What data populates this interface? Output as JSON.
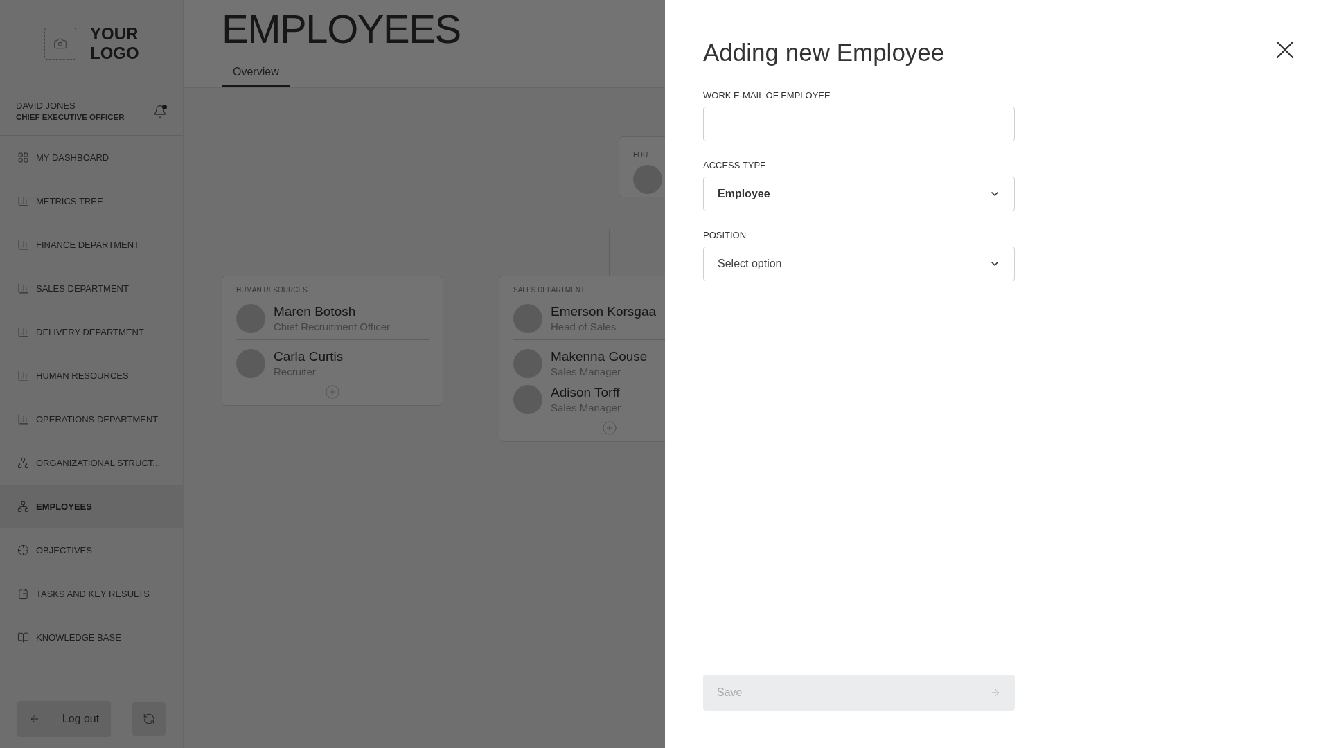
{
  "sidebar": {
    "logo_text": "YOUR LOGO",
    "user": {
      "name": "DAVID JONES",
      "role": "CHIEF EXECUTIVE OFFICER",
      "has_notification": true
    },
    "nav": [
      {
        "kind": "dashboard",
        "label": "MY DASHBOARD",
        "selected": false
      },
      {
        "kind": "metrics",
        "label": "METRICS TREE",
        "selected": false
      },
      {
        "kind": "metrics",
        "label": "FINANCE DEPARTMENT",
        "selected": false
      },
      {
        "kind": "metrics",
        "label": "SALES DEPARTMENT",
        "selected": false
      },
      {
        "kind": "metrics",
        "label": "DELIVERY DEPARTMENT",
        "selected": false
      },
      {
        "kind": "metrics",
        "label": "HUMAN RESOURCES",
        "selected": false
      },
      {
        "kind": "metrics",
        "label": "OPERATIONS DEPARTMENT",
        "selected": false
      },
      {
        "kind": "structure",
        "label": "ORGANIZATIONAL STRUCT...",
        "selected": false
      },
      {
        "kind": "structure",
        "label": "EMPLOYEES",
        "selected": true
      },
      {
        "kind": "objectives",
        "label": "OBJECTIVES",
        "selected": false
      },
      {
        "kind": "tasks",
        "label": "TASKS AND KEY RESULTS",
        "selected": false
      },
      {
        "kind": "knowledge",
        "label": "KNOWLEDGE BASE",
        "selected": false
      }
    ],
    "logout": "Log out"
  },
  "page": {
    "title": "EMPLOYEES",
    "tabs": [
      {
        "label": "Overview",
        "selected": true
      }
    ],
    "org_chart": {
      "top_card": {
        "label": "FOU"
      },
      "departments": [
        {
          "label": "HUMAN RESOURCES",
          "members": [
            {
              "name": "Maren Botosh",
              "role": "Chief Recruitment Officer"
            },
            {
              "name": "Carla Curtis",
              "role": "Recruiter"
            }
          ]
        },
        {
          "label": "SALES DEPARTMENT",
          "members": [
            {
              "name": "Emerson Korsgaa",
              "role": "Head of Sales"
            },
            {
              "name": "Makenna Gouse",
              "role": "Sales Manager"
            },
            {
              "name": "Adison Torff",
              "role": "Sales Manager"
            }
          ]
        }
      ]
    }
  },
  "panel": {
    "title": "Adding new Employee",
    "fields": [
      {
        "kind": "text",
        "label": "WORK E-MAIL OF EMPLOYEE"
      },
      {
        "kind": "select",
        "label": "ACCESS TYPE",
        "value": "Employee"
      },
      {
        "kind": "select",
        "label": "POSITION",
        "placeholder": "Select option"
      }
    ],
    "save": {
      "label": "Save",
      "disabled": true
    }
  }
}
